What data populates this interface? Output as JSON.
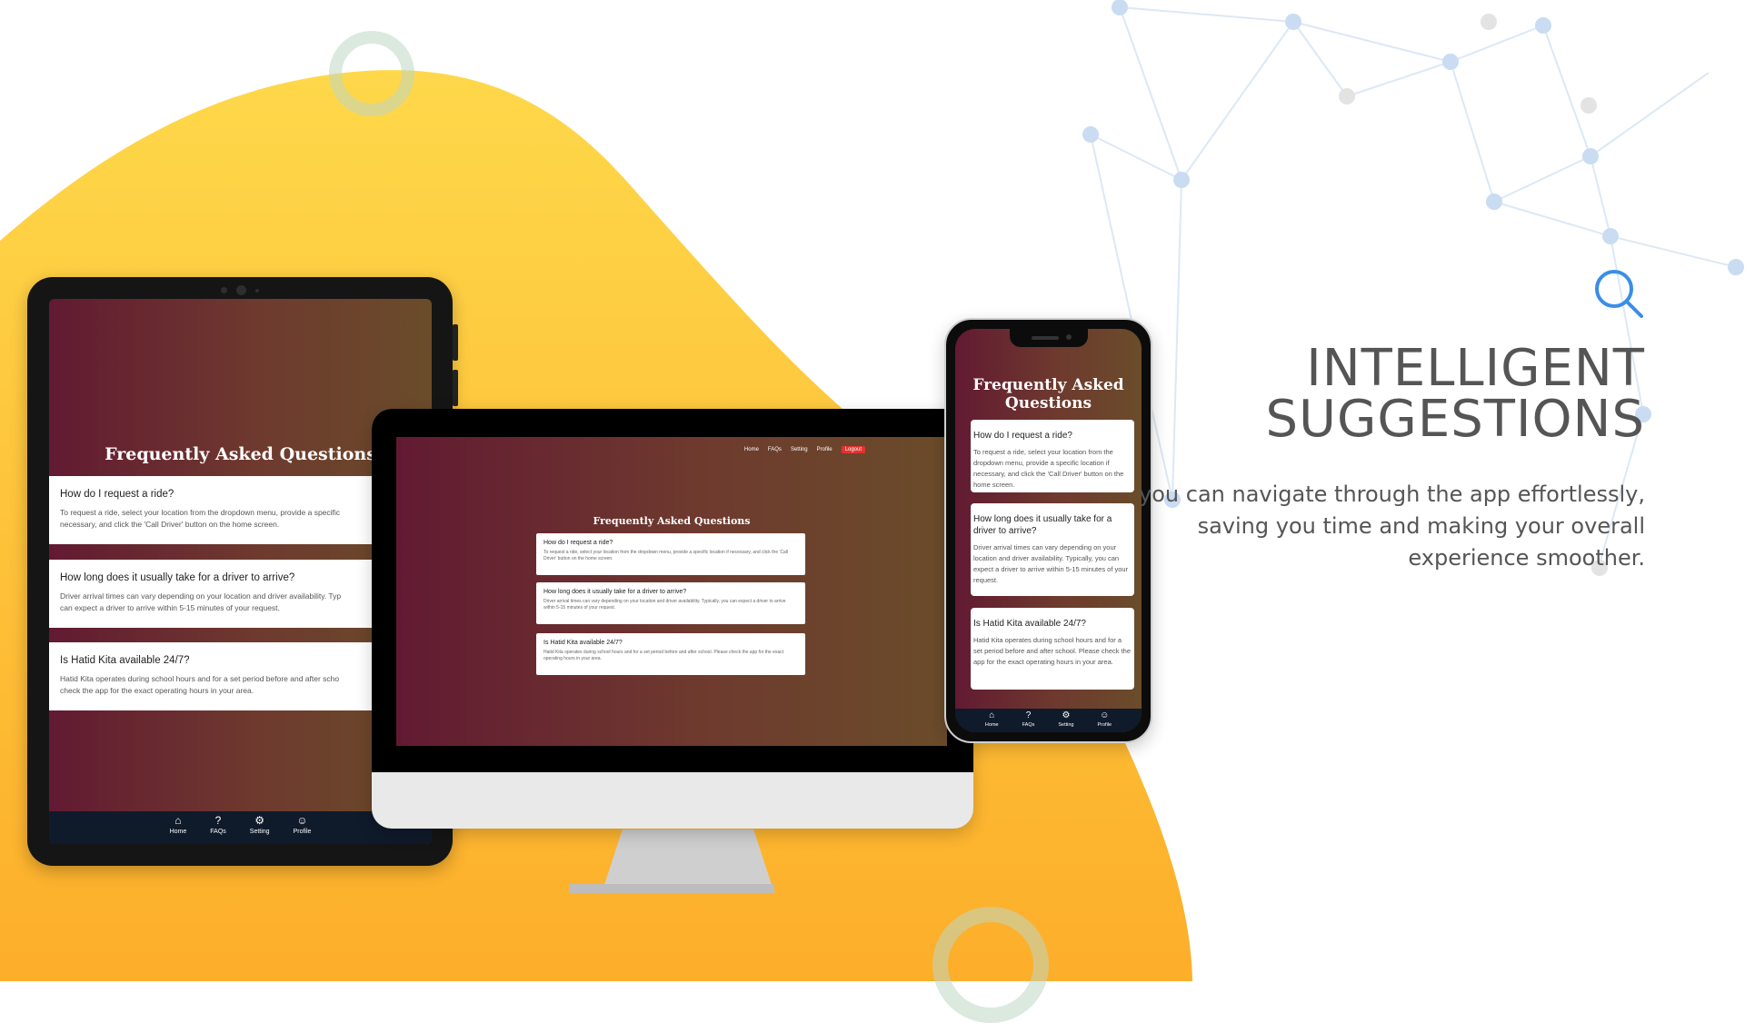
{
  "colors": {
    "accent_yellow": "#fdb52d",
    "screen_gradient_start": "#621a32",
    "screen_gradient_end": "#6a4c2a",
    "nav_bar": "#0f1a2b",
    "logout": "#e4322f",
    "headline": "#555555",
    "search_icon": "#3a8ee6"
  },
  "headline": {
    "line1": "INTELLIGENT",
    "line2": "SUGGESTIONS",
    "icon": "search-icon"
  },
  "description": "you can navigate through the app effortlessly, saving you time and making your overall experience smoother.",
  "faq": {
    "title": "Frequently Asked Questions",
    "phone_title_line1": "Frequently Asked",
    "phone_title_line2": "Questions",
    "items": [
      {
        "question": "How do I request a ride?",
        "answer": "To request a ride, select your location from the dropdown menu, provide a specific location if necessary, and click the 'Call Driver' button on the home screen."
      },
      {
        "question": "How long does it usually take for a driver to arrive?",
        "answer": "Driver arrival times can vary depending on your location and driver availability. Typically, you can expect a driver to arrive within 5-15 minutes of your request."
      },
      {
        "question": "Is Hatid Kita available 24/7?",
        "answer": "Hatid Kita operates during school hours and for a set period before and after school. Please check the app for the exact operating hours in your area."
      }
    ],
    "tablet_answers": [
      "To request a ride, select your location from the dropdown menu, provide a specific",
      "necessary, and click the 'Call Driver' button on the home screen.",
      "Driver arrival times can vary depending on your location and driver availability. Typ",
      "can expect a driver to arrive within 5-15 minutes of your request.",
      "Hatid Kita operates during school hours and for a set period before and after scho",
      "check the app for the exact operating hours in your area."
    ]
  },
  "mobile_nav": [
    {
      "label": "Home",
      "icon": "home-icon",
      "glyph": "⌂"
    },
    {
      "label": "FAQs",
      "icon": "question-icon",
      "glyph": "?"
    },
    {
      "label": "Setting",
      "icon": "gear-icon",
      "glyph": "⚙"
    },
    {
      "label": "Profile",
      "icon": "user-icon",
      "glyph": "☺"
    }
  ],
  "desktop_nav": {
    "home": "Home",
    "faqs": "FAQs",
    "setting": "Setting",
    "profile": "Profile",
    "logout": "Logout"
  }
}
